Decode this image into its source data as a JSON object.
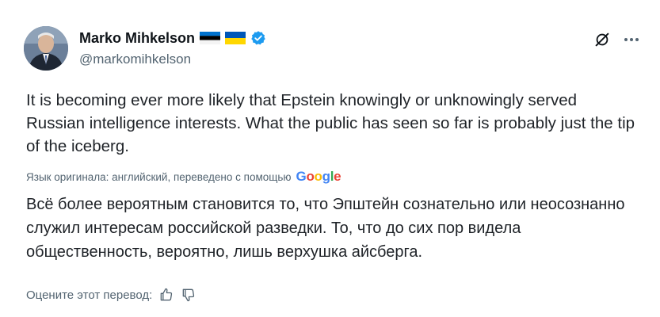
{
  "author": {
    "display_name": "Marko Mihkelson",
    "handle": "@markomihkelson",
    "flags": [
      "estonia-flag-icon",
      "ukraine-flag-icon"
    ],
    "verified_badge": "verified-badge-icon"
  },
  "tweet": {
    "text": "It is becoming ever more likely that Epstein knowingly or unknowingly served Russian intelligence interests. What the public has seen so far is probably just the tip of the iceberg."
  },
  "translation": {
    "note": "Язык оригинала: английский, переведено с помощью",
    "provider_letters": [
      "G",
      "o",
      "o",
      "g",
      "l",
      "e"
    ],
    "text": "Всё более вероятным становится то, что Эпштейн сознательно или неосознанно служил интересам российской разведки. То, что до сих пор видела общественность, вероятно, лишь верхушка айсберга.",
    "rate_prompt": "Оцените этот перевод:"
  },
  "colors": {
    "text_primary": "#0f1419",
    "text_secondary": "#536471",
    "verified_blue": "#1d9bf0",
    "google_blue": "#4285F4",
    "google_red": "#EA4335",
    "google_yellow": "#FBBC05",
    "google_green": "#34A853"
  },
  "icons": [
    "grok-icon",
    "more-icon",
    "thumbs-up-icon",
    "thumbs-down-icon"
  ]
}
